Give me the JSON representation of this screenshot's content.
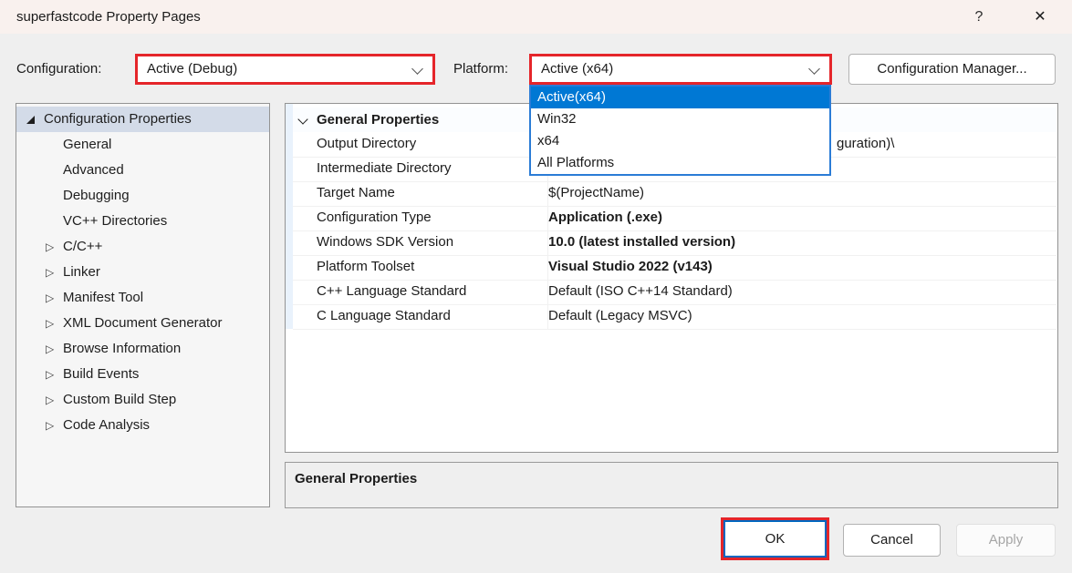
{
  "window": {
    "title": "superfastcode Property Pages",
    "help": "?",
    "close": "✕"
  },
  "toolbar": {
    "configuration_label": "Configuration:",
    "configuration_value": "Active (Debug)",
    "platform_label": "Platform:",
    "platform_value": "Active (x64)",
    "configuration_manager_label": "Configuration Manager..."
  },
  "platform_dropdown": {
    "options": [
      "Active(x64)",
      "Win32",
      "x64",
      "All Platforms"
    ],
    "selected_index": 0
  },
  "icons": {
    "tree_collapsed": "▷"
  },
  "tree": {
    "items": [
      {
        "label": "Configuration Properties"
      },
      {
        "label": "General"
      },
      {
        "label": "Advanced"
      },
      {
        "label": "Debugging"
      },
      {
        "label": "VC++ Directories"
      },
      {
        "label": "C/C++"
      },
      {
        "label": "Linker"
      },
      {
        "label": "Manifest Tool"
      },
      {
        "label": "XML Document Generator"
      },
      {
        "label": "Browse Information"
      },
      {
        "label": "Build Events"
      },
      {
        "label": "Custom Build Step"
      },
      {
        "label": "Code Analysis"
      }
    ]
  },
  "grid": {
    "category": "General Properties",
    "rows": [
      {
        "name": "Output Directory",
        "value": "guration)\\"
      },
      {
        "name": "Intermediate Directory",
        "value": ""
      },
      {
        "name": "Target Name",
        "value": "$(ProjectName)"
      },
      {
        "name": "Configuration Type",
        "value": "Application (.exe)"
      },
      {
        "name": "Windows SDK Version",
        "value": "10.0 (latest installed version)"
      },
      {
        "name": "Platform Toolset",
        "value": "Visual Studio 2022 (v143)"
      },
      {
        "name": "C++ Language Standard",
        "value": "Default (ISO C++14 Standard)"
      },
      {
        "name": "C Language Standard",
        "value": "Default (Legacy MSVC)"
      }
    ]
  },
  "description": {
    "title": "General Properties"
  },
  "footer": {
    "ok": "OK",
    "cancel": "Cancel",
    "apply": "Apply"
  },
  "colors": {
    "annotation_red": "#e5252a",
    "selection_blue": "#0078d4",
    "tree_selection": "#d3dbe8",
    "titlebar": "#f9f1ee",
    "dialog_bg": "#efefef"
  }
}
